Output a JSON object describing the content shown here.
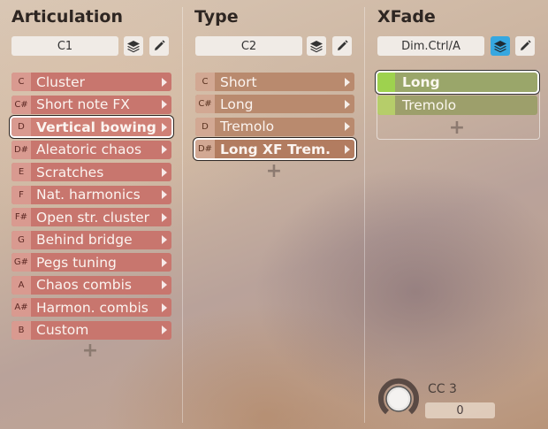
{
  "articulation": {
    "title": "Articulation",
    "field": "C1",
    "items": [
      {
        "note": "C",
        "label": "Cluster"
      },
      {
        "note": "C#",
        "label": "Short note FX"
      },
      {
        "note": "D",
        "label": "Vertical bowing"
      },
      {
        "note": "D#",
        "label": "Aleatoric chaos"
      },
      {
        "note": "E",
        "label": "Scratches"
      },
      {
        "note": "F",
        "label": "Nat. harmonics"
      },
      {
        "note": "F#",
        "label": "Open str. cluster"
      },
      {
        "note": "G",
        "label": "Behind bridge"
      },
      {
        "note": "G#",
        "label": "Pegs tuning"
      },
      {
        "note": "A",
        "label": "Chaos combis"
      },
      {
        "note": "A#",
        "label": "Harmon. combis"
      },
      {
        "note": "B",
        "label": "Custom"
      }
    ],
    "selected_index": 2,
    "add_label": "+"
  },
  "type": {
    "title": "Type",
    "field": "C2",
    "items": [
      {
        "note": "C",
        "label": "Short"
      },
      {
        "note": "C#",
        "label": "Long"
      },
      {
        "note": "D",
        "label": "Tremolo"
      },
      {
        "note": "D#",
        "label": "Long XF Trem."
      }
    ],
    "selected_index": 3,
    "add_label": "+"
  },
  "xfade": {
    "title": "XFade",
    "field": "Dim.Ctrl/A",
    "layers_active": true,
    "items": [
      {
        "label": "Long"
      },
      {
        "label": "Tremolo"
      }
    ],
    "selected_index": 0,
    "add_label": "+"
  },
  "controller": {
    "label": "CC 3",
    "value": "0"
  },
  "colors": {
    "articulation_row": "#c8766e",
    "type_row": "#b98a6e",
    "xfade_swatch": "#9ed24e",
    "active_button": "#36a7e0"
  },
  "icons": {
    "layers": "layers-icon",
    "edit": "pencil-icon"
  }
}
